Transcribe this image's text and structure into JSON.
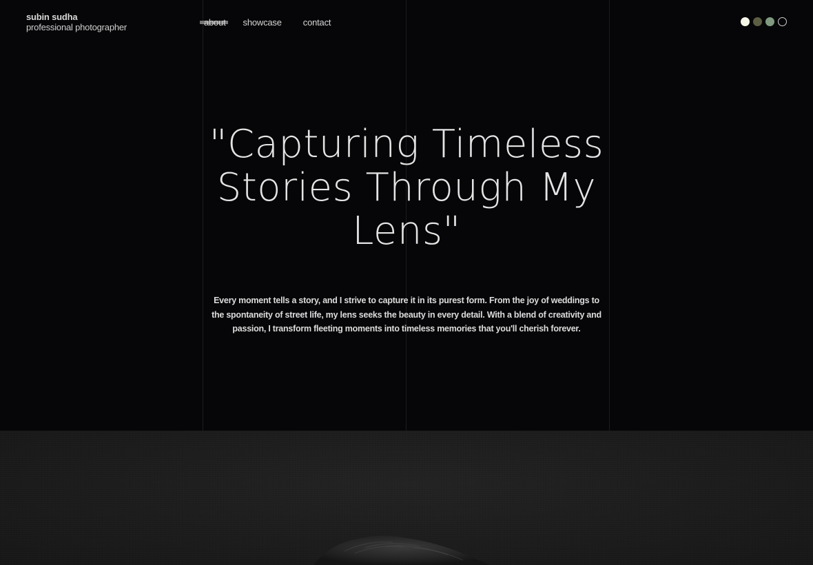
{
  "brand": {
    "name": "subin sudha",
    "tagline": "professional photographer"
  },
  "nav": {
    "items": [
      {
        "label": "about",
        "active": true
      },
      {
        "label": "showcase",
        "active": false
      },
      {
        "label": "contact",
        "active": false
      }
    ]
  },
  "theme_switcher": {
    "swatches": [
      {
        "name": "light",
        "color": "#f6f6e8"
      },
      {
        "name": "olive",
        "color": "#5c5e44"
      },
      {
        "name": "sage",
        "color": "#7f9a80"
      },
      {
        "name": "dark",
        "color": "#060608"
      }
    ]
  },
  "hero": {
    "headline": "\"Capturing Timeless Stories Through My Lens\"",
    "intro": "Every moment tells a story, and I strive to capture it in its purest form. From the joy of weddings to the spontaneity of street life, my lens seeks the beauty in every detail. With a blend of creativity and passion, I transform fleeting moments into timeless memories that you'll cherish forever."
  },
  "colors": {
    "background": "#060608",
    "text": "#e4e4e4",
    "nav_highlight": "#8a8a8a"
  }
}
